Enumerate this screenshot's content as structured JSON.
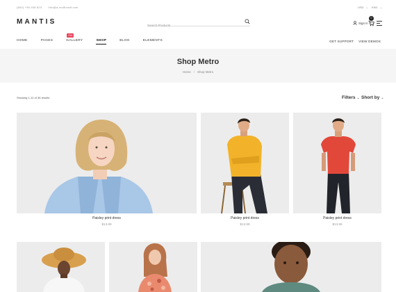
{
  "topbar": {
    "phone": "(800) +96 456 823",
    "email": "info@a-multicraft.com",
    "currency": "USD",
    "language": "ENG"
  },
  "header": {
    "logo": "MANTIS",
    "search_placeholder": "Search Products",
    "signin_label": "Sign in",
    "cart_count": "0"
  },
  "nav": {
    "items": [
      {
        "label": "HOME"
      },
      {
        "label": "PAGES"
      },
      {
        "label": "GALLERY",
        "badge": "Hot"
      },
      {
        "label": "SHOP"
      },
      {
        "label": "BLOG"
      },
      {
        "label": "ELEMENTS"
      }
    ],
    "right": [
      "GET SUPPORT",
      "VIEW DEMOS"
    ]
  },
  "hero": {
    "title": "Shop Metro",
    "breadcrumb": [
      "Home",
      "Shop Metro"
    ]
  },
  "toolbar": {
    "results": "Showing 1-12 of 36 results",
    "filters_label": "Filters",
    "sort_label": "Short by"
  },
  "products": [
    {
      "name": "Paisley print dress",
      "price": "$13.99"
    },
    {
      "name": "Paisley print dress",
      "price": "$13.99"
    },
    {
      "name": "Paisley print dress",
      "price": "$13.99"
    }
  ],
  "colors": {
    "accent": "#e94560",
    "hero_bg": "#f5f5f5",
    "text": "#222222"
  }
}
